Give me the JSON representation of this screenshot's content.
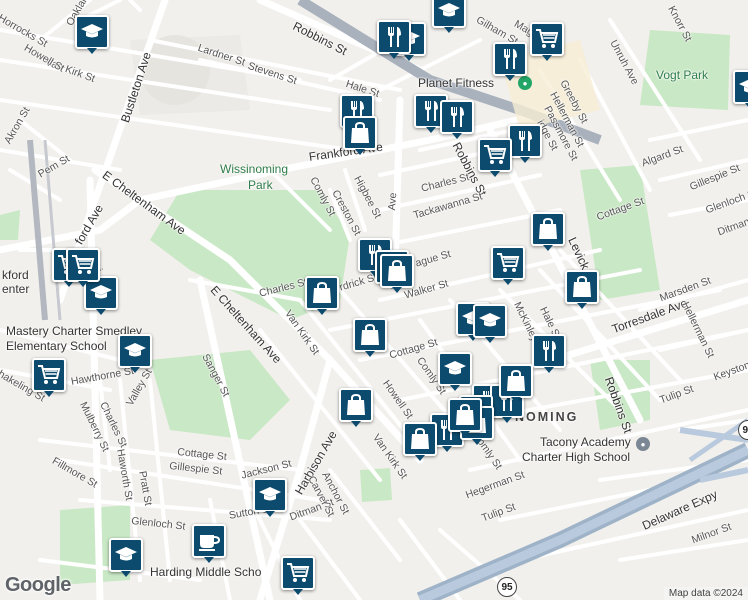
{
  "map": {
    "attribution": "Map data ©2024",
    "provider": "Google",
    "neighborhood": "WISSINOMING",
    "neighborhood_visible": "NOMING",
    "parks": [
      "Wissinoming Park",
      "Vogt Park"
    ],
    "places": [
      "Planet Fitness",
      "Tacony Academy Charter High School",
      "Harding Middle School",
      "Mastery Charter Smedley Elementary School"
    ],
    "place_labels_visible": {
      "planet_fitness": "Planet Fitness",
      "tacony_1": "Tacony Academy",
      "tacony_2": "Charter High School",
      "harding": "Harding Middle Scho",
      "mastery_1": "Mastery Charter Smedley",
      "mastery_2": "Elementary School",
      "frankford_center": "kford",
      "frankford_center_2": "enter",
      "wissinoming_1": "Wissinoming",
      "wissinoming_2": "Park",
      "vogt": "Vogt Park"
    },
    "streets": {
      "robbins_top": "Robbins St",
      "robbins_mid": "Robbins St",
      "robbins_low": "Robbins St",
      "bustleton": "Bustleton Ave",
      "e_cheltenham": "E Cheltenham Ave",
      "e_cheltenham_2": "E Cheltenham Ave",
      "frankford": "Frankford Ave",
      "frankford_west": "ford Ave",
      "torresdale": "Torresdale Ave",
      "levick": "Levick St",
      "harbison": "Harbison Ave",
      "delaware": "Delaware Expy",
      "lardner": "Lardner St",
      "stevens": "Stevens St",
      "hale": "Hale St",
      "hale2": "Hale St",
      "van_kirk": "Van Kirk St",
      "van_kirk2": "Van Kirk St",
      "van_kirk3": "Van Kirk St",
      "charles": "Charles St",
      "charles2": "Charles St",
      "charles3": "Charles St",
      "tackawanna": "Tackawanna St",
      "walker": "Walker St",
      "comly": "Comly St",
      "comly2": "Comly St",
      "comly3": "Comly St",
      "creston": "Creston St",
      "higbee": "Higbee St",
      "cottage": "Cottage St",
      "cottage2": "Cottage St",
      "cottage3": "Cottage St",
      "gillespie": "Gillespie St",
      "gillespie2": "Gillespie St",
      "algard": "Algard St",
      "marsden": "Marsden St",
      "howell": "Howell St",
      "howell2": "Howell St",
      "tulip": "Tulip St",
      "tulip2": "Tulip St",
      "hegerman": "Hegerman St",
      "hegerman2": "Hegerman St",
      "mckinley": "McKinley St",
      "glenloch": "Glenloch St",
      "glenloch2": "Glenloch St",
      "ditman": "Ditman St",
      "ditman2": "Ditman St",
      "anchor": "Anchor St",
      "carver": "Carver St",
      "jackson": "Jackson St",
      "sanger": "Sanger St",
      "pratt": "Pratt St",
      "haworth": "Haworth St",
      "hawthorne": "Hawthorne St",
      "mulberry": "Mulberry St",
      "charles_w": "Charles St",
      "valley": "Valley St",
      "fillmore": "Fillmore St",
      "pem": "Pem St",
      "akron": "Akron St",
      "horrocks": "Horrocks St",
      "oakland": "Oakland St",
      "magee": "Magee Ave",
      "gilham": "Gilham St",
      "knorr": "Knorr St",
      "unruh": "Unruh Ave",
      "greeby": "Greeby St",
      "hellerman": "Hellerman St",
      "hellerman2": "Hellerman St",
      "passmore": "Passmore St",
      "bridge": "Bridge St",
      "keystone": "Keyston",
      "milnor": "Milnor St",
      "bridge2": "Bri",
      "orthodox": "ague St",
      "burdrick": "rdrick St",
      "walker_w": "Walker St",
      "sutton": "Sutton St",
      "tul": "Tul",
      "haklng": "hakeling St",
      "haw": "Haw",
      "man": "man St",
      "er": "er St",
      "ing": "ing St",
      "ridge": "idge St",
      "ave_label": "Ave",
      "ave_label2": "Ave",
      "ford_ave": "ford Ave",
      "gle": "Glenloch St",
      "dit": "Ditman"
    },
    "shields": [
      "95",
      "95"
    ],
    "markers": [
      {
        "type": "school",
        "icon": "graduation-cap-icon"
      },
      {
        "type": "school",
        "icon": "graduation-cap-icon"
      },
      {
        "type": "school",
        "icon": "graduation-cap-icon"
      },
      {
        "type": "school",
        "icon": "graduation-cap-icon"
      },
      {
        "type": "school",
        "icon": "graduation-cap-icon"
      },
      {
        "type": "school",
        "icon": "graduation-cap-icon"
      },
      {
        "type": "school",
        "icon": "graduation-cap-icon"
      },
      {
        "type": "school",
        "icon": "graduation-cap-icon"
      },
      {
        "type": "school",
        "icon": "graduation-cap-icon"
      },
      {
        "type": "school",
        "icon": "graduation-cap-icon"
      },
      {
        "type": "school",
        "icon": "graduation-cap-icon"
      },
      {
        "type": "restaurant",
        "icon": "fork-knife-icon"
      },
      {
        "type": "restaurant",
        "icon": "fork-knife-icon"
      },
      {
        "type": "restaurant",
        "icon": "fork-knife-icon"
      },
      {
        "type": "restaurant",
        "icon": "fork-knife-icon"
      },
      {
        "type": "restaurant",
        "icon": "fork-knife-icon"
      },
      {
        "type": "restaurant",
        "icon": "fork-knife-icon"
      },
      {
        "type": "restaurant",
        "icon": "fork-knife-icon"
      },
      {
        "type": "restaurant",
        "icon": "fork-knife-icon"
      },
      {
        "type": "restaurant",
        "icon": "fork-knife-icon"
      },
      {
        "type": "restaurant",
        "icon": "fork-knife-icon"
      },
      {
        "type": "restaurant",
        "icon": "fork-knife-icon"
      },
      {
        "type": "restaurant",
        "icon": "fork-knife-icon"
      },
      {
        "type": "grocery",
        "icon": "shopping-cart-icon"
      },
      {
        "type": "grocery",
        "icon": "shopping-cart-icon"
      },
      {
        "type": "grocery",
        "icon": "shopping-cart-icon"
      },
      {
        "type": "grocery",
        "icon": "shopping-cart-icon"
      },
      {
        "type": "grocery",
        "icon": "shopping-cart-icon"
      },
      {
        "type": "grocery",
        "icon": "shopping-cart-icon"
      },
      {
        "type": "grocery",
        "icon": "shopping-cart-icon"
      },
      {
        "type": "shopping",
        "icon": "shopping-bag-icon"
      },
      {
        "type": "shopping",
        "icon": "shopping-bag-icon"
      },
      {
        "type": "shopping",
        "icon": "shopping-bag-icon"
      },
      {
        "type": "shopping",
        "icon": "shopping-bag-icon"
      },
      {
        "type": "shopping",
        "icon": "shopping-bag-icon"
      },
      {
        "type": "shopping",
        "icon": "shopping-bag-icon"
      },
      {
        "type": "shopping",
        "icon": "shopping-bag-icon"
      },
      {
        "type": "shopping",
        "icon": "shopping-bag-icon"
      },
      {
        "type": "shopping",
        "icon": "shopping-bag-icon"
      },
      {
        "type": "shopping",
        "icon": "shopping-bag-icon"
      },
      {
        "type": "shopping",
        "icon": "shopping-bag-icon"
      },
      {
        "type": "shopping",
        "icon": "shopping-bag-icon"
      },
      {
        "type": "cafe",
        "icon": "coffee-cup-icon"
      }
    ]
  }
}
